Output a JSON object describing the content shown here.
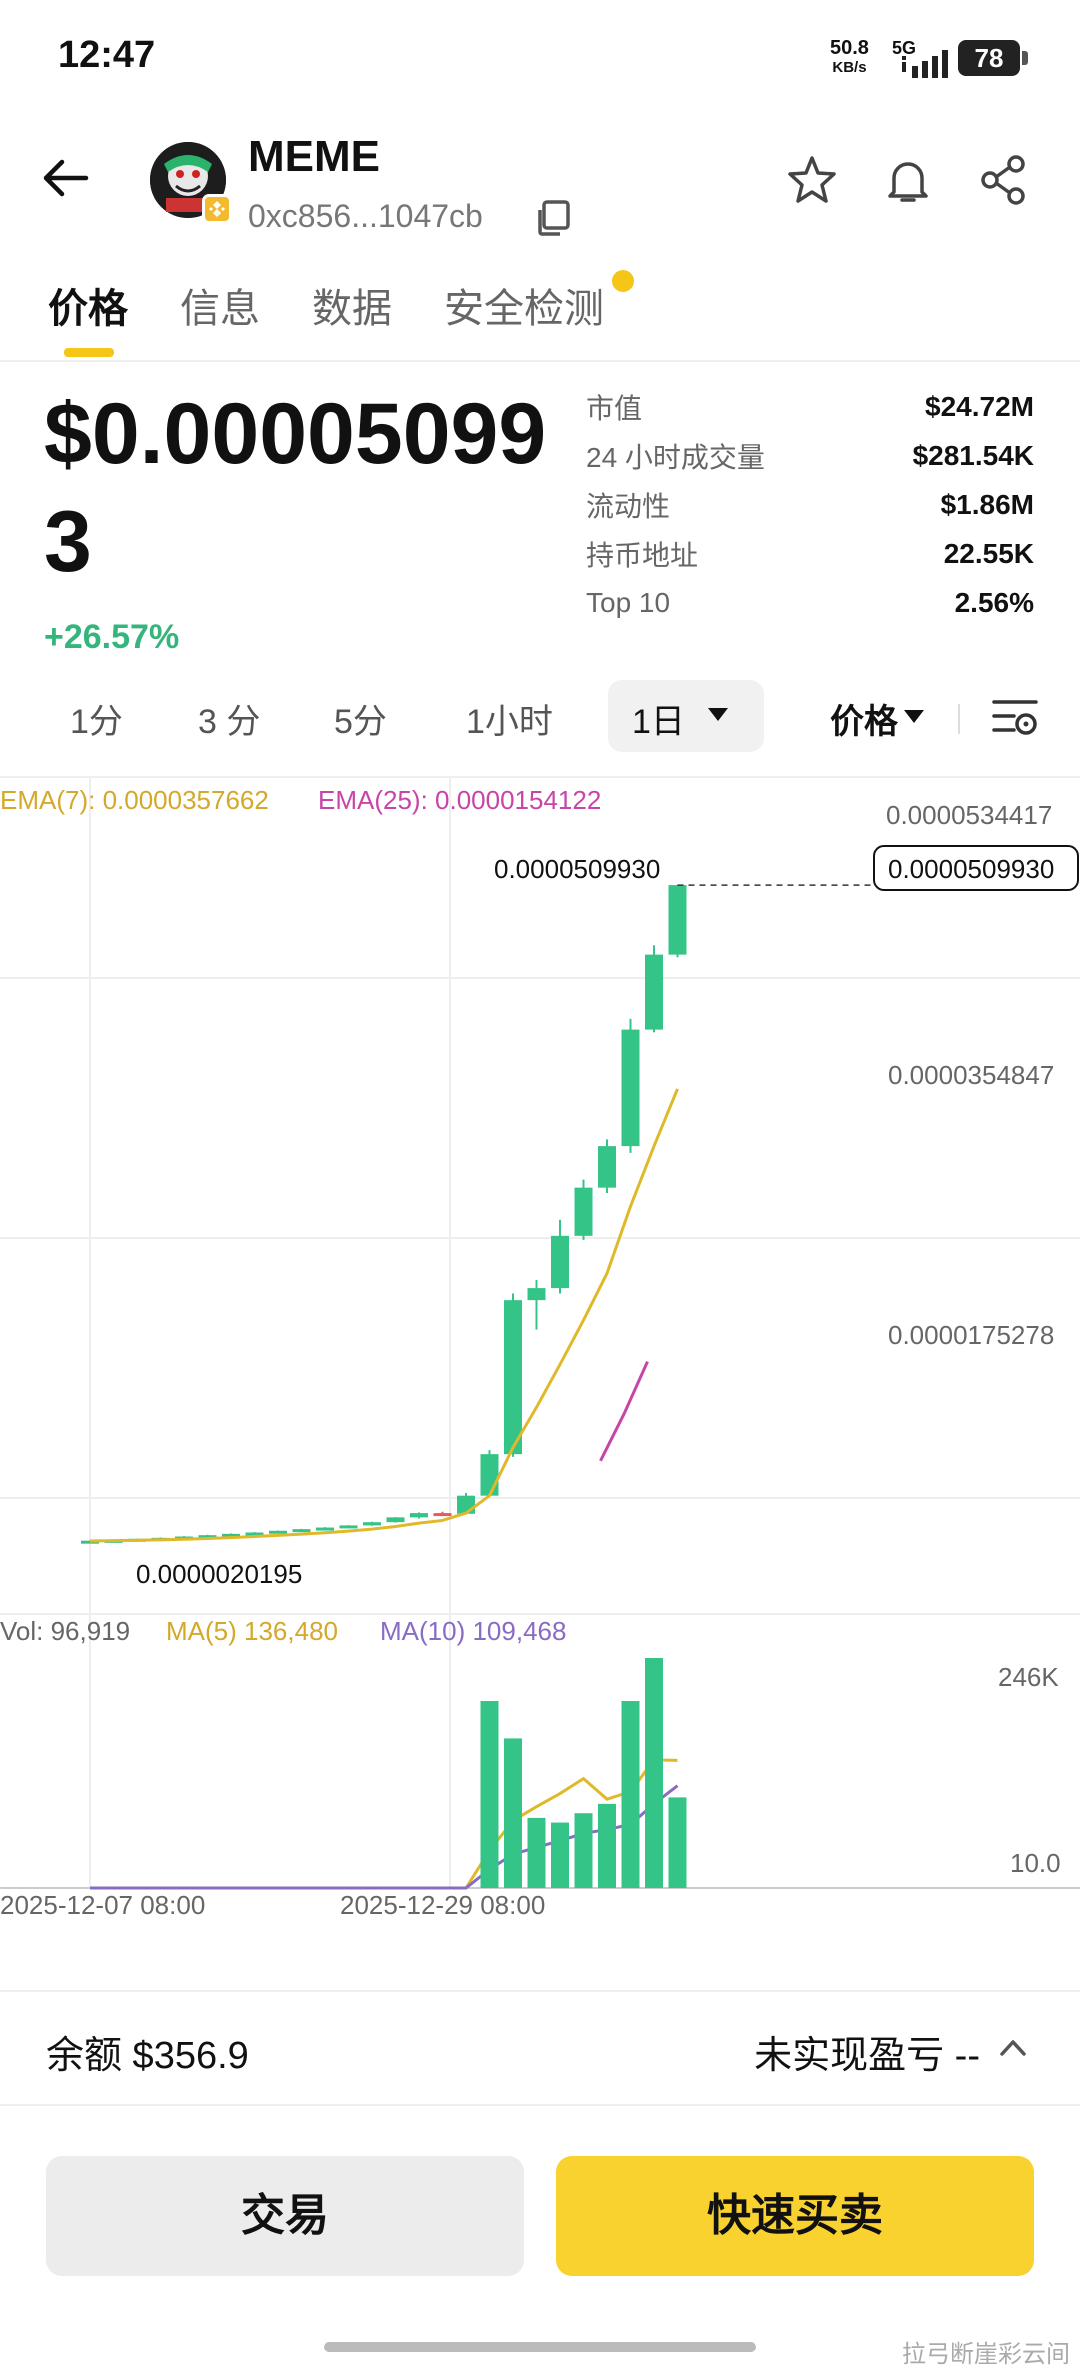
{
  "status_bar": {
    "time": "12:47",
    "net_speed": "50.8",
    "net_unit": "KB/s",
    "network": "5G",
    "battery": "78"
  },
  "header": {
    "token_name": "MEME",
    "address": "0xc856...1047cb",
    "icons": [
      "back-arrow-icon",
      "star-icon",
      "bell-icon",
      "share-icon",
      "copy-icon"
    ]
  },
  "tabs": [
    {
      "label": "价格",
      "active": true
    },
    {
      "label": "信息",
      "active": false
    },
    {
      "label": "数据",
      "active": false
    },
    {
      "label": "安全检测",
      "active": false
    }
  ],
  "price": {
    "value": "$0.000050993",
    "change": "+26.57%"
  },
  "stats": [
    {
      "label": "市值",
      "value": "$24.72M"
    },
    {
      "label": "24 小时成交量",
      "value": "$281.54K"
    },
    {
      "label": "流动性",
      "value": "$1.86M"
    },
    {
      "label": "持币地址",
      "value": "22.55K"
    },
    {
      "label": "Top 10",
      "value": "2.56%"
    }
  ],
  "intervals": {
    "options": [
      "1分",
      "3 分",
      "5分",
      "1小时"
    ],
    "selected": "1日",
    "price_toggle": "价格"
  },
  "chart_data": {
    "type": "candlestick",
    "indicators": {
      "ema7_label": "EMA(7): 0.0000357662",
      "ema25_label": "EMA(25): 0.0000154122",
      "vol_label": "Vol: 96,919",
      "ma5_label": "MA(5) 136,480",
      "ma10_label": "MA(10) 109,468"
    },
    "y_ticks": [
      "0.0000534417",
      "0.0000354847",
      "0.0000175278"
    ],
    "current_price_label": "0.0000509930",
    "high_label": "0.0000509930",
    "low_label": "0.0000020195",
    "volume_ticks": [
      "246K",
      "10.0"
    ],
    "x_ticks": [
      "2025-12-07 08:00",
      "2025-12-29 08:00"
    ],
    "colors": {
      "up": "#35c488",
      "down": "#e85a5a",
      "ema7": "#e0b92a",
      "ema25": "#c845a8",
      "ma10": "#8a6bc4"
    },
    "candles": [
      {
        "o": 2.02,
        "h": 2.05,
        "l": 1.98,
        "c": 2.04
      },
      {
        "o": 2.04,
        "h": 2.12,
        "l": 2.02,
        "c": 2.1
      },
      {
        "o": 2.1,
        "h": 2.2,
        "l": 2.08,
        "c": 2.18
      },
      {
        "o": 2.18,
        "h": 2.28,
        "l": 2.15,
        "c": 2.25
      },
      {
        "o": 2.25,
        "h": 2.38,
        "l": 2.22,
        "c": 2.35
      },
      {
        "o": 2.35,
        "h": 2.48,
        "l": 2.32,
        "c": 2.45
      },
      {
        "o": 2.45,
        "h": 2.58,
        "l": 2.42,
        "c": 2.55
      },
      {
        "o": 2.55,
        "h": 2.68,
        "l": 2.52,
        "c": 2.65
      },
      {
        "o": 2.65,
        "h": 2.8,
        "l": 2.62,
        "c": 2.78
      },
      {
        "o": 2.78,
        "h": 2.92,
        "l": 2.75,
        "c": 2.9
      },
      {
        "o": 2.9,
        "h": 3.05,
        "l": 2.88,
        "c": 3.02
      },
      {
        "o": 3.02,
        "h": 3.2,
        "l": 3.0,
        "c": 3.18
      },
      {
        "o": 3.18,
        "h": 3.45,
        "l": 3.15,
        "c": 3.42
      },
      {
        "o": 3.42,
        "h": 3.8,
        "l": 3.4,
        "c": 3.78
      },
      {
        "o": 3.78,
        "h": 4.15,
        "l": 3.7,
        "c": 4.1
      },
      {
        "o": 4.1,
        "h": 4.2,
        "l": 3.9,
        "c": 4.05
      },
      {
        "o": 4.05,
        "h": 5.6,
        "l": 4.0,
        "c": 5.4
      },
      {
        "o": 5.4,
        "h": 8.8,
        "l": 5.3,
        "c": 8.5
      },
      {
        "o": 8.5,
        "h": 20.5,
        "l": 8.3,
        "c": 20.0
      },
      {
        "o": 20.0,
        "h": 21.5,
        "l": 17.8,
        "c": 20.9
      },
      {
        "o": 20.9,
        "h": 26.0,
        "l": 20.5,
        "c": 24.8
      },
      {
        "o": 24.8,
        "h": 29.0,
        "l": 24.5,
        "c": 28.4
      },
      {
        "o": 28.4,
        "h": 32.0,
        "l": 28.0,
        "c": 31.5
      },
      {
        "o": 31.5,
        "h": 41.0,
        "l": 31.0,
        "c": 40.2
      },
      {
        "o": 40.2,
        "h": 46.5,
        "l": 40.0,
        "c": 45.8
      },
      {
        "o": 45.8,
        "h": 51.0,
        "l": 45.6,
        "c": 50.99
      }
    ],
    "volumes": [
      0,
      0,
      0,
      0,
      0,
      0,
      0,
      0,
      0,
      0,
      0,
      0,
      0,
      0,
      0,
      0,
      0,
      200000,
      160000,
      75000,
      70000,
      80000,
      90000,
      200000,
      246000,
      96919
    ],
    "ema7": [
      2.02,
      2.04,
      2.07,
      2.1,
      2.15,
      2.2,
      2.27,
      2.35,
      2.44,
      2.53,
      2.63,
      2.75,
      2.9,
      3.1,
      3.35,
      3.55,
      4.1,
      5.4,
      9.0,
      12.0,
      15.2,
      18.5,
      22.0,
      27.0,
      31.5,
      35.77
    ],
    "ema25": [
      null,
      null,
      null,
      null,
      null,
      null,
      null,
      null,
      null,
      null,
      null,
      null,
      null,
      null,
      null,
      null,
      null,
      null,
      null,
      null,
      null,
      null,
      null,
      8.0,
      11.5,
      15.41
    ],
    "ma5": [
      0,
      0,
      0,
      0,
      0,
      0,
      0,
      0,
      0,
      0,
      0,
      0,
      0,
      0,
      0,
      0,
      0,
      40000,
      72000,
      87000,
      101000,
      117000,
      95000,
      103000,
      137000,
      136480
    ],
    "ma10": [
      0,
      0,
      0,
      0,
      0,
      0,
      0,
      0,
      0,
      0,
      0,
      0,
      0,
      0,
      0,
      0,
      0,
      20000,
      36000,
      43500,
      50500,
      58500,
      62500,
      68000,
      90000,
      109468
    ],
    "y_range": [
      0,
      56
    ],
    "unit_scale": "1e-6"
  },
  "footer": {
    "balance": "余额 $356.9",
    "unrealized_pnl": "未实现盈亏 --",
    "trade_button": "交易",
    "quick_button": "快速买卖"
  },
  "watermark": "拉弓断崖彩云间"
}
